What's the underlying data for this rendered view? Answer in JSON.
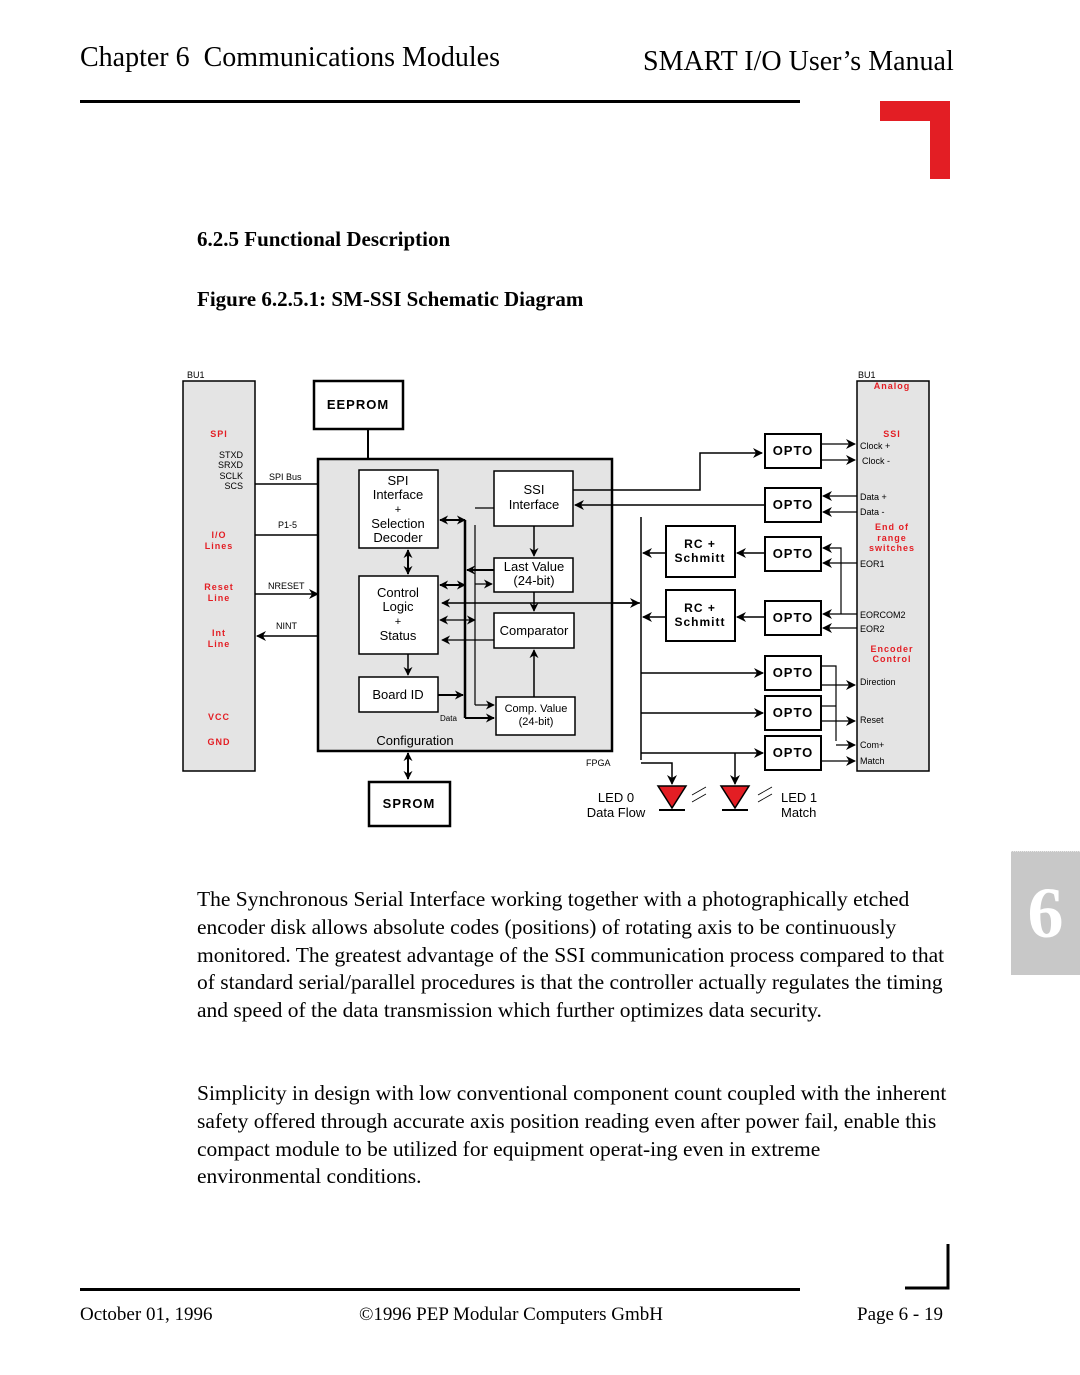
{
  "header": {
    "chapter": "Chapter 6  Communications Modules",
    "manual": "SMART I/O User’s Manual"
  },
  "section": {
    "title": "6.2.5 Functional Description",
    "figure_caption": "Figure 6.2.5.1: SM-SSI Schematic Diagram"
  },
  "diagram": {
    "accent_color": "#e31e24",
    "left_connector": {
      "label": "BU1",
      "groups": {
        "spi": "SPI",
        "io": [
          "I/O",
          "Lines"
        ],
        "reset": [
          "Reset",
          "Line"
        ],
        "int": [
          "Int",
          "Line"
        ],
        "vcc": "VCC",
        "gnd": "GND"
      },
      "signals": [
        "STXD",
        "SRXD",
        "SCLK",
        "SCS"
      ]
    },
    "wires": {
      "spi_bus": "SPI Bus",
      "p1_5": "P1-5",
      "nreset": "NRESET",
      "nint": "NINT",
      "data": "Data"
    },
    "blocks": {
      "eeprom": "EEPROM",
      "sprom": "SPROM",
      "spi_interface": [
        "SPI",
        "Interface",
        "+",
        "Selection",
        "Decoder"
      ],
      "ssi_interface": [
        "SSI",
        "Interface"
      ],
      "last_value": [
        "Last Value",
        "(24-bit)"
      ],
      "control_logic": [
        "Control",
        "Logic",
        "+",
        "Status"
      ],
      "comparator": "Comparator",
      "board_id": "Board ID",
      "comp_value": [
        "Comp. Value",
        "(24-bit)"
      ],
      "configuration": "Configuration",
      "fpga": "FPGA",
      "opto": "OPTO",
      "rc_schmitt": [
        "RC +",
        "Schmitt"
      ]
    },
    "leds": [
      {
        "label": "LED 0",
        "sub": "Data Flow"
      },
      {
        "label": "LED 1",
        "sub": "Match"
      }
    ],
    "right_connector": {
      "label": "BU1",
      "groups": {
        "analog": "Analog",
        "ssi": "SSI",
        "end_of_range": [
          "End of",
          "range",
          "switches"
        ],
        "encoder": [
          "Encoder",
          "Control"
        ]
      },
      "signals": {
        "clock_p": "Clock +",
        "clock_m": "Clock -",
        "data_p": "Data +",
        "data_m": "Data -",
        "eor1": "EOR1",
        "eorcom2": "EORCOM2",
        "eor2": "EOR2",
        "direction": "Direction",
        "reset": "Reset",
        "com": "Com+",
        "match": "Match"
      }
    }
  },
  "body": {
    "paragraph1": "The Synchronous Serial Interface working together with a photographically etched encoder disk allows absolute codes (positions) of rotating axis to be continuously monitored. The greatest advantage of the SSI communication process compared to that of standard serial/parallel procedures is that the controller actually regulates the timing and speed of the data transmission which further optimizes data security.",
    "paragraph2": "Simplicity in design with low conventional component count coupled with the inherent safety offered through accurate axis position reading even after power fail, enable this compact module to be utilized for equipment operat-ing even in extreme environmental conditions."
  },
  "thumb_tab": "6",
  "footer": {
    "date": "October 01, 1996",
    "copyright": "©1996 PEP Modular Computers GmbH",
    "page": "Page 6 - 19"
  }
}
